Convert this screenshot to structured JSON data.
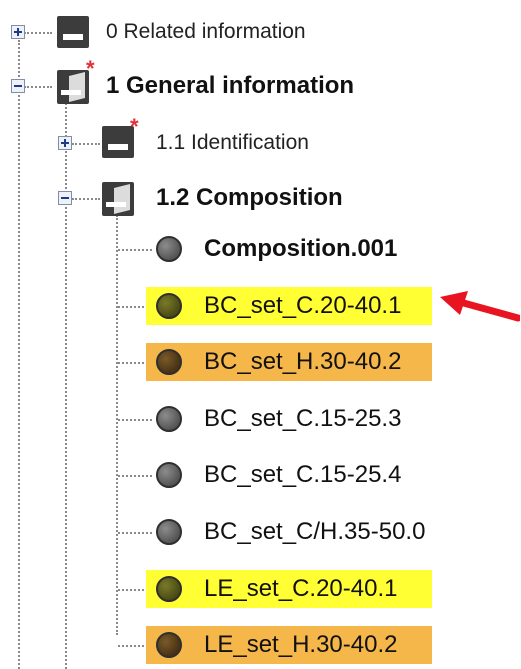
{
  "tree": {
    "related": {
      "label": "0 Related information"
    },
    "general": {
      "label": "1 General information"
    },
    "identification": {
      "label": "1.1 Identification"
    },
    "composition": {
      "label": "1.2 Composition"
    },
    "items": [
      {
        "label": "Composition.001",
        "bold": true,
        "color": "grey",
        "highlight": "none"
      },
      {
        "label": "BC_set_C.20-40.1",
        "bold": false,
        "color": "olive",
        "highlight": "yellow"
      },
      {
        "label": "BC_set_H.30-40.2",
        "bold": false,
        "color": "brown",
        "highlight": "orange"
      },
      {
        "label": "BC_set_C.15-25.3",
        "bold": false,
        "color": "grey",
        "highlight": "none"
      },
      {
        "label": "BC_set_C.15-25.4",
        "bold": false,
        "color": "grey",
        "highlight": "none"
      },
      {
        "label": "BC_set_C/H.35-50.0",
        "bold": false,
        "color": "grey",
        "highlight": "none"
      },
      {
        "label": "LE_set_C.20-40.1",
        "bold": false,
        "color": "olive",
        "highlight": "yellow"
      },
      {
        "label": "LE_set_H.30-40.2",
        "bold": false,
        "color": "brown",
        "highlight": "orange"
      }
    ]
  },
  "colors": {
    "highlight_yellow": "#ffff33",
    "highlight_orange": "#f5b64a",
    "arrow": "#e8141f",
    "modified_flag": "#e0303a"
  },
  "annotation": {
    "arrow_target": "BC_set_C.20-40.1"
  }
}
